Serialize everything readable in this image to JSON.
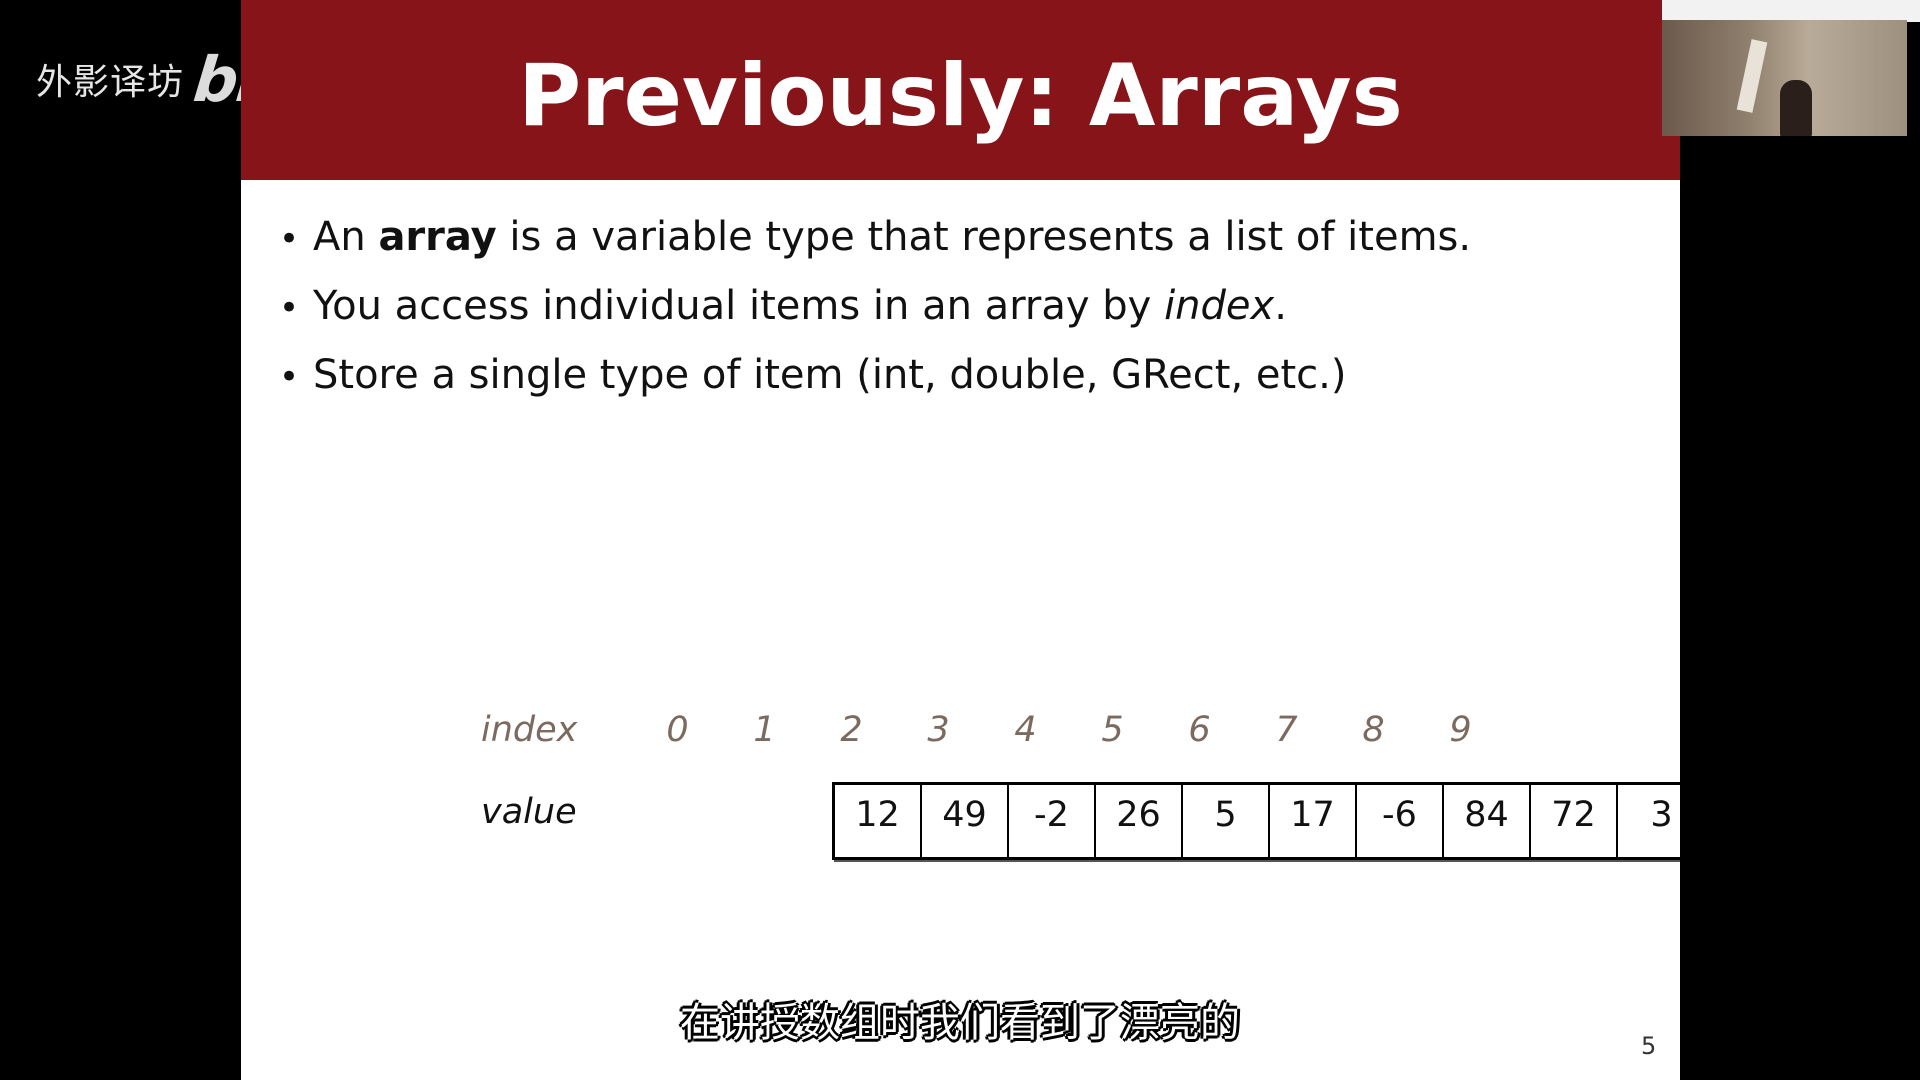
{
  "watermark": {
    "text": "外影译坊",
    "logo": "bilibili"
  },
  "slide": {
    "title": "Previously: Arrays",
    "bullets": [
      {
        "before": "An ",
        "emph": "array",
        "after": " is a variable type that represents a list of items."
      },
      {
        "before": "You access individual items in an array by ",
        "emph": "index",
        "after": "."
      },
      {
        "before": "Store a single type of item (int, double, GRect, etc.)",
        "emph": "",
        "after": ""
      }
    ],
    "array": {
      "index_label": "index",
      "value_label": "value",
      "indices": [
        "0",
        "1",
        "2",
        "3",
        "4",
        "5",
        "6",
        "7",
        "8",
        "9"
      ],
      "values": [
        "12",
        "49",
        "-2",
        "26",
        "5",
        "17",
        "-6",
        "84",
        "72",
        "3"
      ]
    },
    "page_number": "5"
  },
  "subtitle": "在讲授数组时我们看到了漂亮的",
  "colors": {
    "title_bar": "#861419",
    "index_text": "#7a6a60"
  }
}
